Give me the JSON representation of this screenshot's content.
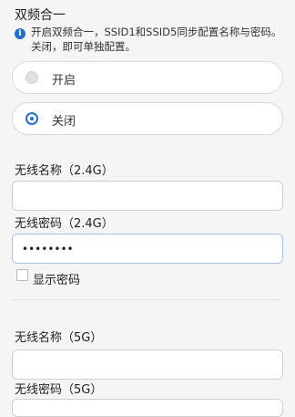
{
  "dual_band": {
    "title": "双频合一",
    "info": "开启双频合一，SSID1和SSID5同步配置名称与密码。关闭，即可单独配置。",
    "options": [
      {
        "label": "开启",
        "selected": false
      },
      {
        "label": "关闭",
        "selected": true
      }
    ]
  },
  "band24": {
    "name_label": "无线名称（2.4G）",
    "name_value": "",
    "password_label": "无线密码（2.4G）",
    "password_value": "••••••••"
  },
  "show_password": {
    "label": "显示密码",
    "checked": false
  },
  "band5": {
    "name_label": "无线名称（5G）",
    "name_value": "",
    "password_label": "无线密码（5G）"
  },
  "colors": {
    "accent": "#1e6fd0",
    "background": "#f5f5f5"
  }
}
